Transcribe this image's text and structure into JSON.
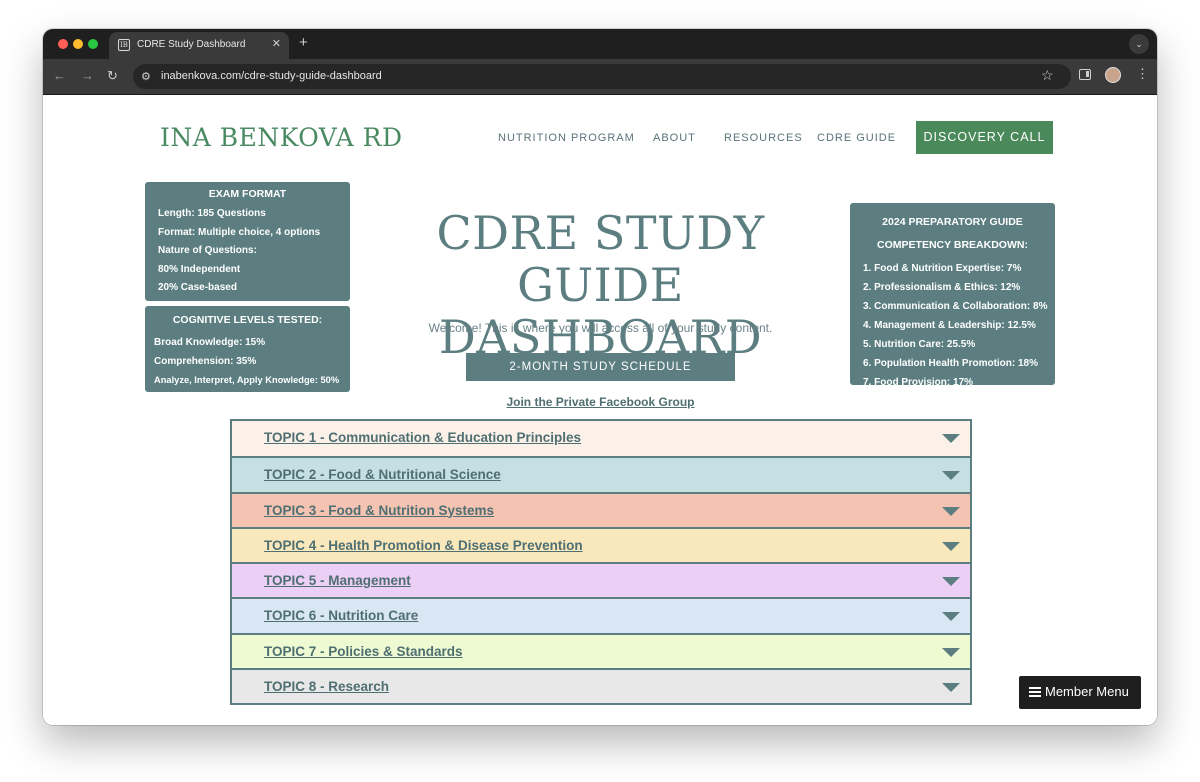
{
  "browser": {
    "tab_title": "CDRE Study Dashboard",
    "tab_favicon_text": "IB",
    "close_glyph": "✕",
    "newtab_glyph": "+",
    "tabmenu_glyph": "⌄",
    "url": "inabenkova.com/cdre-study-guide-dashboard",
    "icons": {
      "back": "←",
      "forward": "→",
      "reload": "↻",
      "site": "⚙",
      "star": "☆",
      "kebab": "⋮"
    }
  },
  "header": {
    "logo": "INA BENKOVA RD",
    "nav": [
      {
        "label": "NUTRITION PROGRAM"
      },
      {
        "label": "ABOUT"
      },
      {
        "label": "RESOURCES"
      },
      {
        "label": "CDRE GUIDE"
      }
    ],
    "cta": "DISCOVERY CALL"
  },
  "exam_format": {
    "title": "EXAM FORMAT",
    "lines": [
      "Length: 185 Questions",
      "Format: Multiple choice, 4 options",
      "Nature of Questions:",
      "80% Independent",
      "20% Case-based"
    ]
  },
  "cognitive_levels": {
    "title": "COGNITIVE LEVELS TESTED:",
    "lines": [
      "Broad Knowledge: 15%",
      "Comprehension: 35%",
      "Analyze, Interpret, Apply Knowledge: 50%"
    ]
  },
  "competency": {
    "title_line1": "2024 PREPARATORY GUIDE",
    "title_line2": "COMPETENCY BREAKDOWN:",
    "lines": [
      "1. Food & Nutrition Expertise: 7%",
      "2. Professionalism & Ethics: 12%",
      "3. Communication & Collaboration: 8%",
      "4. Management & Leadership: 12.5%",
      "5. Nutrition Care: 25.5%",
      "6. Population Health Promotion: 18%",
      "7. Food Provision: 17%"
    ]
  },
  "hero": {
    "title_line1": "CDRE STUDY GUIDE",
    "title_line2": "DASHBOARD",
    "welcome": "Welcome! This is where you will access all of your study content.",
    "schedule_button": "2-MONTH STUDY SCHEDULE",
    "facebook_link": "Join the Private Facebook Group"
  },
  "topics": [
    {
      "label": "TOPIC 1 - Communication & Education Principles",
      "color": "#fbf1e8"
    },
    {
      "label": "TOPIC 2 - Food & Nutritional Science",
      "color": "#c6dfe2"
    },
    {
      "label": "TOPIC 3 - Food & Nutrition Systems",
      "color": "#f4c3b2"
    },
    {
      "label": "TOPIC 4 - Health Promotion & Disease Prevention",
      "color": "#f9e8bc"
    },
    {
      "label": "TOPIC 5 - Management",
      "color": "#ebcff4"
    },
    {
      "label": "TOPIC 6 - Nutrition Care",
      "color": "#d9e6f3"
    },
    {
      "label": "TOPIC 7 - Policies & Standards",
      "color": "#eefbd2"
    },
    {
      "label": "TOPIC 8 - Research",
      "color": "#e8e8e8"
    }
  ],
  "member_menu": {
    "label": "Member Menu"
  }
}
